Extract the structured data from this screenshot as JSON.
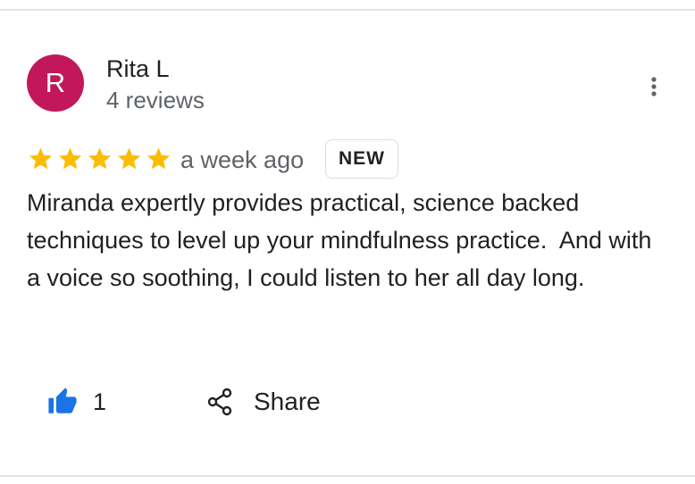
{
  "reviewer": {
    "initial": "R",
    "name": "Rita L",
    "review_count": "4 reviews",
    "avatar_color": "#c2185b"
  },
  "menu": {
    "icon": "more-vert-icon"
  },
  "rating": {
    "stars": 5,
    "max_stars": 5,
    "star_color": "#fbbc04"
  },
  "review": {
    "age": "a week ago",
    "badge": "NEW",
    "text": "Miranda expertly provides practical, science backed techniques to level up your mindfulness practice.  And with a voice so soothing, I could listen to her all day long."
  },
  "actions": {
    "like_icon": "thumbs-up-icon",
    "like_count": "1",
    "like_color": "#1a73e8",
    "share_icon": "share-icon",
    "share_label": "Share"
  }
}
